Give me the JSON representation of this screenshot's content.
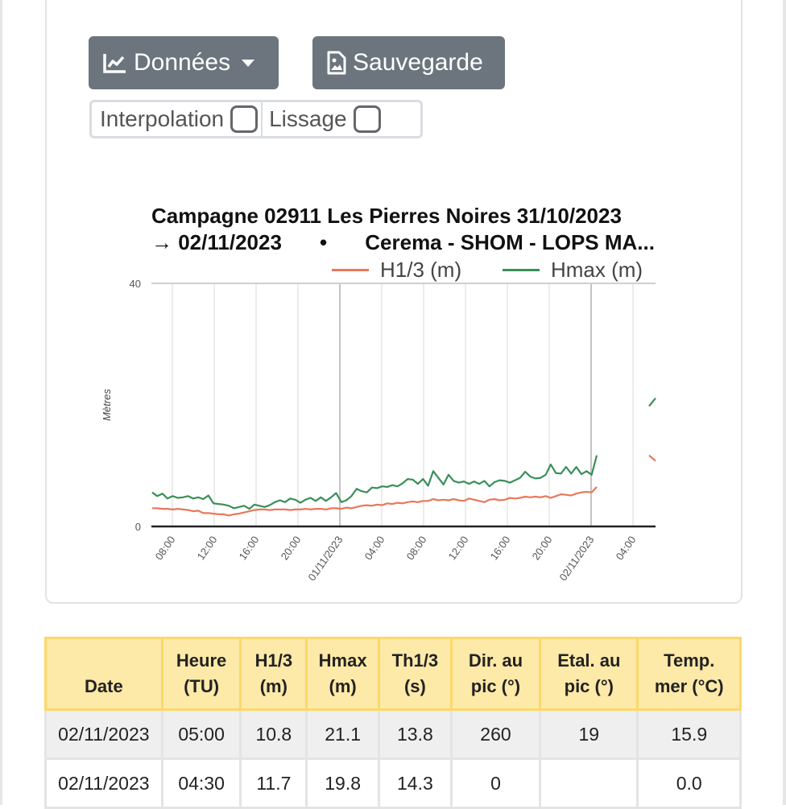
{
  "toolbar": {
    "donnees_label": "Données",
    "sauvegarde_label": "Sauvegarde"
  },
  "options": {
    "interpolation_label": "Interpolation",
    "lissage_label": "Lissage",
    "interpolation_checked": false,
    "lissage_checked": false
  },
  "chart_data": {
    "type": "line",
    "title_line1": "Campagne 02911 Les Pierres Noires 31/10/2023",
    "title_line2_left": "→ 02/11/2023",
    "title_line2_sep": "•",
    "title_line2_right": "Cerema - SHOM - LOPS MA...",
    "ylabel": "Mètres",
    "ylim": [
      0,
      40
    ],
    "yticks": [
      "0",
      "40"
    ],
    "xticks": [
      "08:00",
      "12:00",
      "16:00",
      "20:00",
      "01/11/2023",
      "04:00",
      "08:00",
      "12:00",
      "16:00",
      "20:00",
      "02/11/2023",
      "04:00"
    ],
    "legend_position": "top-right",
    "grid": true,
    "series": [
      {
        "name": "H1/3 (m)",
        "color": "#e8785a",
        "values": [
          3.0,
          3.0,
          2.9,
          2.9,
          2.8,
          2.9,
          2.8,
          2.7,
          2.5,
          2.6,
          2.2,
          2.2,
          2.1,
          2.0,
          2.0,
          1.8,
          2.0,
          2.1,
          2.3,
          2.5,
          2.7,
          2.8,
          2.8,
          2.7,
          2.8,
          2.8,
          2.8,
          2.7,
          2.8,
          2.8,
          2.9,
          2.8,
          2.9,
          2.9,
          2.8,
          3.0,
          3.0,
          2.9,
          3.1,
          3.0,
          3.2,
          3.4,
          3.5,
          3.4,
          3.6,
          3.5,
          3.8,
          3.7,
          3.9,
          3.8,
          4.0,
          4.1,
          4.0,
          4.2,
          4.2,
          4.5,
          4.3,
          4.4,
          4.3,
          4.5,
          4.3,
          4.2,
          4.6,
          4.4,
          4.2,
          4.0,
          4.4,
          4.5,
          4.3,
          4.4,
          4.7,
          4.6,
          4.7,
          4.9,
          4.8,
          4.9,
          4.8,
          5.0,
          4.7,
          5.0,
          5.3,
          5.2,
          5.1,
          5.4,
          5.6,
          5.7,
          5.6,
          6.5
        ],
        "end_values": [
          11.7,
          10.8
        ]
      },
      {
        "name": "Hmax (m)",
        "color": "#3a8f5a",
        "values": [
          5.6,
          5.0,
          5.4,
          4.6,
          5.0,
          4.7,
          4.8,
          5.0,
          4.6,
          4.8,
          4.5,
          5.1,
          3.8,
          3.7,
          3.6,
          3.4,
          3.0,
          3.2,
          3.4,
          2.9,
          3.6,
          3.4,
          3.2,
          3.5,
          4.0,
          4.3,
          4.0,
          4.6,
          4.4,
          3.9,
          4.4,
          4.7,
          4.2,
          4.8,
          4.2,
          4.8,
          5.5,
          4.0,
          4.3,
          5.0,
          6.2,
          5.8,
          5.6,
          6.4,
          6.3,
          6.6,
          6.5,
          6.8,
          6.6,
          7.1,
          7.8,
          7.7,
          7.0,
          7.8,
          6.7,
          9.1,
          8.0,
          6.9,
          8.5,
          7.5,
          7.2,
          7.4,
          7.0,
          7.4,
          7.0,
          7.5,
          6.6,
          7.3,
          7.6,
          7.5,
          7.2,
          7.6,
          8.0,
          9.0,
          8.2,
          7.9,
          8.0,
          8.5,
          10.2,
          8.8,
          8.7,
          9.8,
          8.7,
          9.8,
          8.6,
          9.1,
          8.5,
          11.7
        ],
        "end_values": [
          19.8,
          21.1
        ]
      }
    ]
  },
  "table": {
    "headers": [
      [
        "",
        "Date"
      ],
      [
        "Heure",
        "(TU)"
      ],
      [
        "H1/3",
        "(m)"
      ],
      [
        "Hmax",
        "(m)"
      ],
      [
        "Th1/3",
        "(s)"
      ],
      [
        "Dir. au",
        "pic (°)"
      ],
      [
        "Etal. au",
        "pic (°)"
      ],
      [
        "Temp.",
        "mer (°C)"
      ]
    ],
    "rows": [
      [
        "02/11/2023",
        "05:00",
        "10.8",
        "21.1",
        "13.8",
        "260",
        "19",
        "15.9"
      ],
      [
        "02/11/2023",
        "04:30",
        "11.7",
        "19.8",
        "14.3",
        "0",
        "",
        "0.0"
      ]
    ]
  }
}
